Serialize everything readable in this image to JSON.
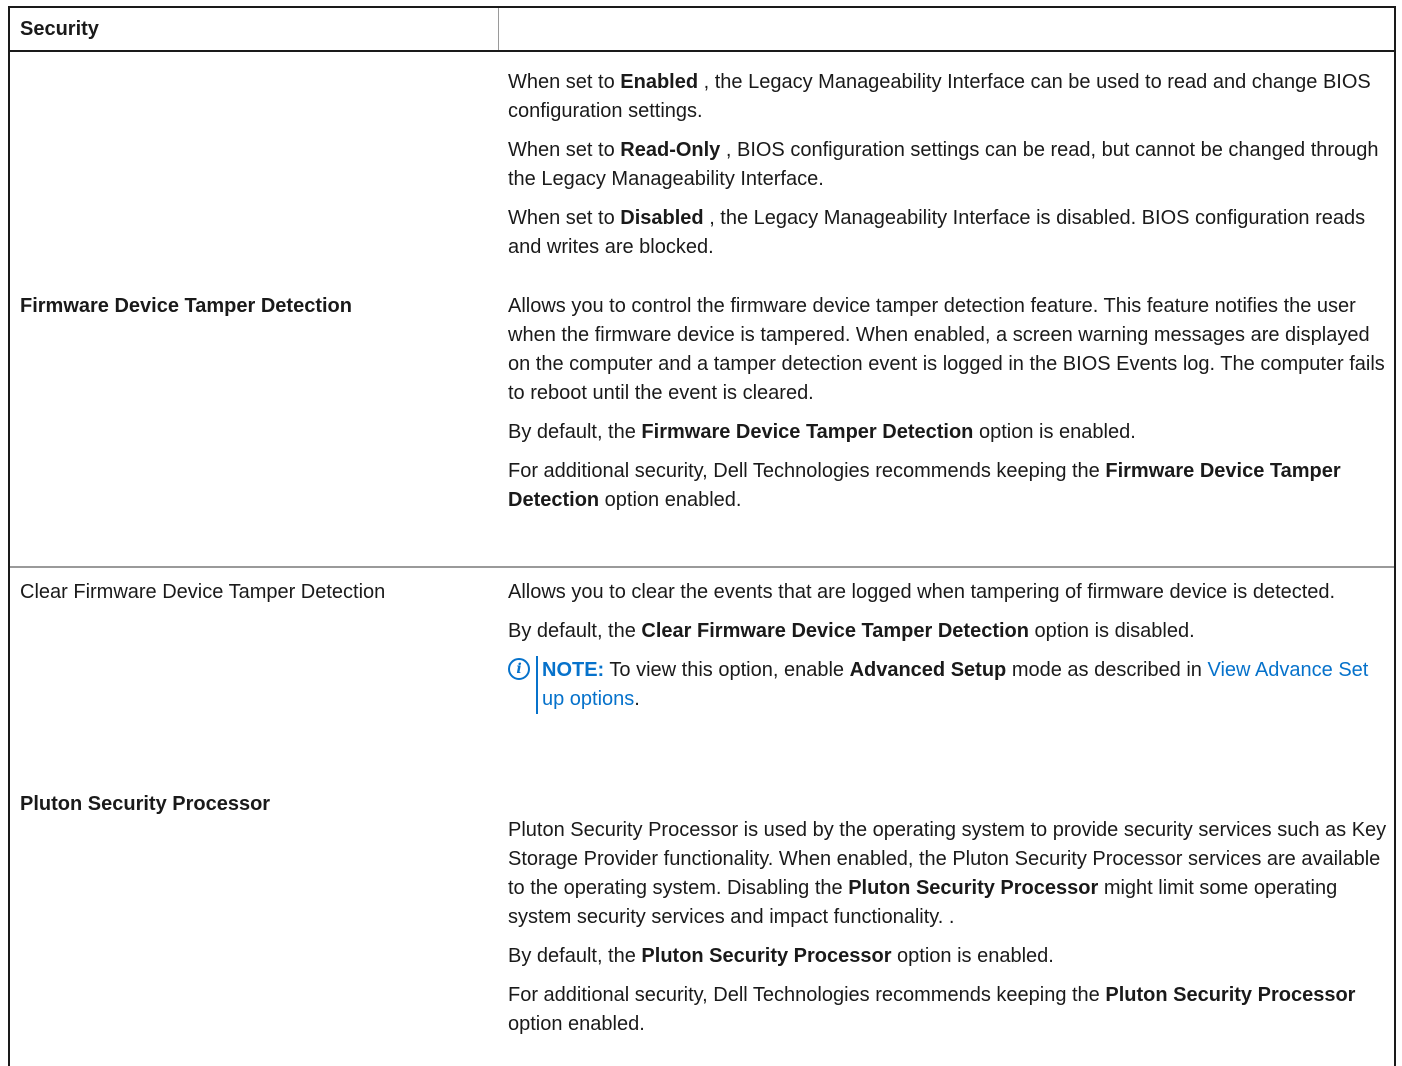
{
  "table": {
    "header": "Security",
    "rows": [
      {
        "setting": "",
        "paragraphs": [
          {
            "pre": "When set to ",
            "b": "Enabled",
            "post": " , the Legacy Manageability Interface can be used to read and change BIOS configuration settings."
          },
          {
            "pre": "When set to ",
            "b": "Read-Only",
            "post": " , BIOS configuration settings can be read, but cannot be changed through the Legacy Manageability Interface."
          },
          {
            "pre": "When set to ",
            "b": "Disabled",
            "post": " , the Legacy Manageability Interface is disabled. BIOS configuration reads and writes are blocked."
          }
        ]
      },
      {
        "setting": "Firmware Device Tamper Detection",
        "paragraphs": [
          {
            "text": "Allows you to control the firmware device tamper detection feature. This feature notifies the user when the firmware device is tampered. When enabled, a screen warning messages are displayed on the computer and a tamper detection event is logged in the BIOS Events log. The computer fails to reboot until the event is cleared."
          },
          {
            "pre": "By default, the ",
            "b": "Firmware Device Tamper Detection",
            "post": " option is enabled."
          },
          {
            "pre": "For additional security, Dell Technologies recommends keeping the ",
            "b": "Firmware Device Tamper Detection",
            "post": " option enabled."
          }
        ]
      },
      {
        "setting": "Clear Firmware Device Tamper Detection",
        "paragraphs": [
          {
            "text": "Allows you to clear the events that are logged when tampering of firmware device is detected."
          },
          {
            "pre": "By default, the ",
            "b": "Clear Firmware Device Tamper Detection",
            "post": " option is disabled."
          }
        ],
        "note": {
          "label": "NOTE:",
          "pre": " To view this option, enable ",
          "b": "Advanced Setup",
          "post": " mode as described in ",
          "link": "View Advance Set up options",
          "end": "."
        }
      },
      {
        "setting": "Pluton Security Processor",
        "paragraphs": [
          {
            "pre": "Pluton Security Processor is used by the operating system to provide security services such as Key Storage Provider functionality. When enabled, the Pluton Security Processor services are available to the operating system. Disabling the ",
            "b": "Pluton Security Processor",
            "post": " might limit some operating system security services and impact functionality. ."
          },
          {
            "pre": "By default, the ",
            "b": "Pluton Security Processor",
            "post": " option is enabled."
          },
          {
            "pre": "For additional security, Dell Technologies recommends keeping the ",
            "b": "Pluton Security Processor",
            "post": " option enabled."
          }
        ]
      }
    ]
  }
}
